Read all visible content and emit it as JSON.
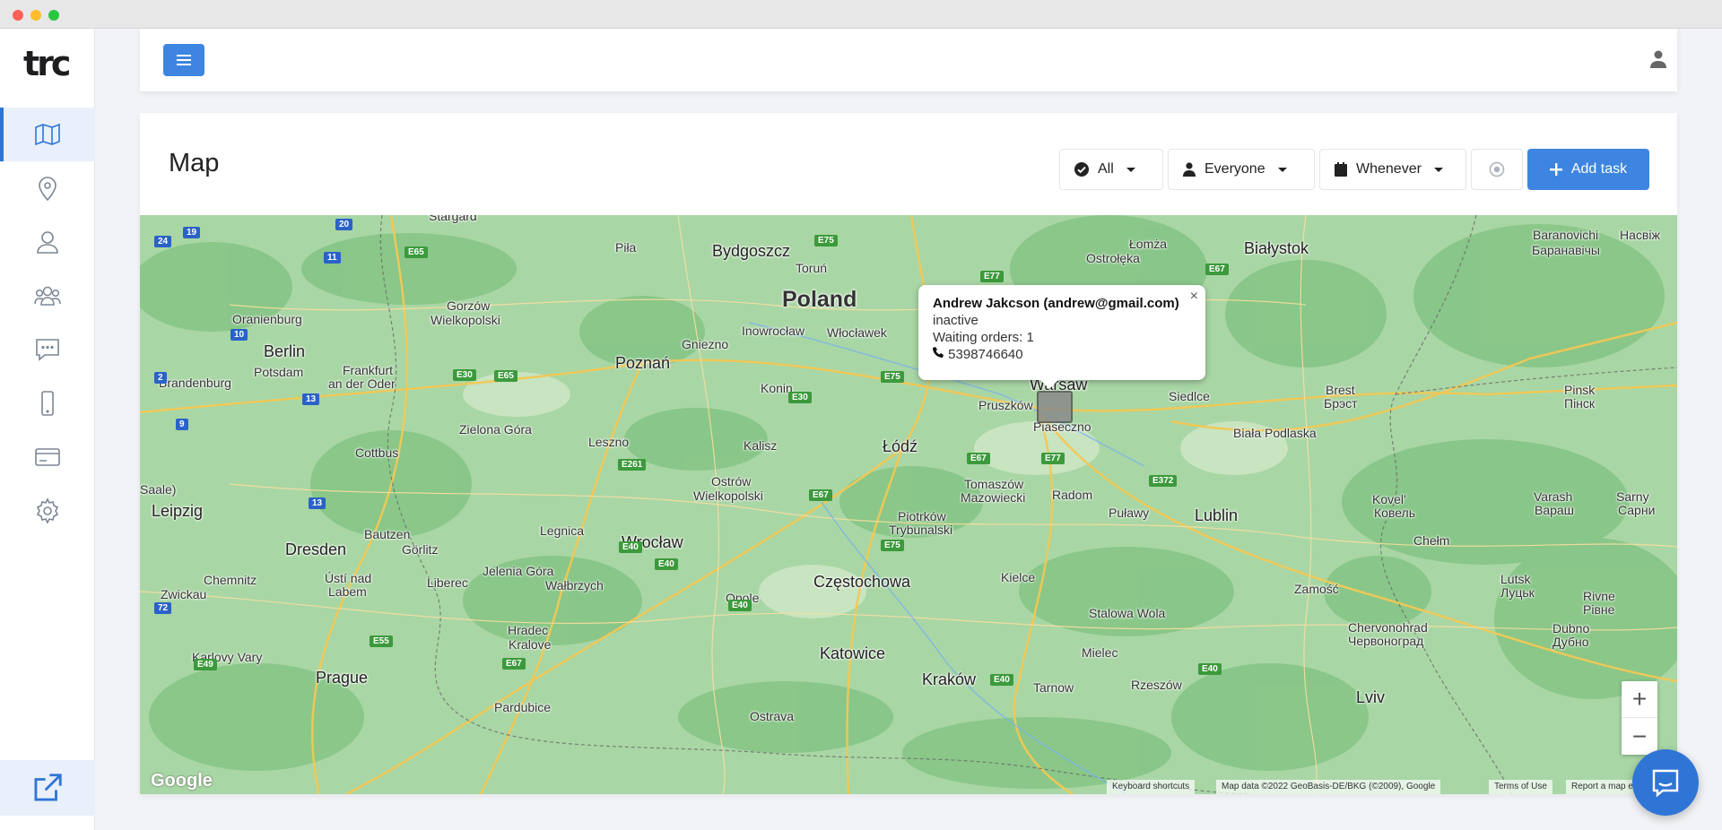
{
  "app": {
    "logo_text": "trc"
  },
  "sidebar": {
    "items": [
      {
        "id": "map",
        "icon": "map-icon",
        "active": true
      },
      {
        "id": "locations",
        "icon": "location-pin-icon"
      },
      {
        "id": "user",
        "icon": "user-icon"
      },
      {
        "id": "team",
        "icon": "users-icon"
      },
      {
        "id": "messages",
        "icon": "chat-icon"
      },
      {
        "id": "devices",
        "icon": "mobile-icon"
      },
      {
        "id": "billing",
        "icon": "credit-card-icon"
      },
      {
        "id": "settings",
        "icon": "gear-icon"
      }
    ],
    "bottom_icon": "external-link-icon"
  },
  "topbar": {
    "menu_icon": "hamburger-icon",
    "user_icon": "user-icon"
  },
  "page": {
    "title": "Map"
  },
  "filters": {
    "status": "All",
    "assignee": "Everyone",
    "date": "Whenever"
  },
  "actions": {
    "add_task": "Add task"
  },
  "popup": {
    "name": "Andrew Jakcson (andrew@gmail.com)",
    "status": "inactive",
    "waiting_orders": "Waiting orders: 1",
    "phone": "5398746640",
    "close": "×"
  },
  "map": {
    "country_label": "Poland",
    "cities": [
      "Bydgoszcz",
      "Białystok",
      "Baranovichi",
      "Насвіж",
      "Баранавічы",
      "Stargard",
      "Piła",
      "Toruń",
      "Łomża",
      "Ostrołęka",
      "Oranienburg",
      "Gorzów",
      "Wielkopolski",
      "Berlin",
      "Inowrocław",
      "Włocławek",
      "Potsdam",
      "Brandenburg",
      "Frankfurt",
      "an der Oder",
      "Poznań",
      "Gniezno",
      "Konin",
      "Warsaw",
      "Pruszków",
      "Piaseczno",
      "Siedlce",
      "Brest",
      "Брэст",
      "Pinsk",
      "Пінск",
      "Zielona Góra",
      "Biała Podlaska",
      "Cottbus",
      "Leszno",
      "Kalisz",
      "Łódź",
      "Saale)",
      "Leipzig",
      "Ostrów",
      "Wielkopolski",
      "Tomaszów",
      "Mazowiecki",
      "Radom",
      "Kovel'",
      "Ковель",
      "Varash",
      "Вараш",
      "Sarny",
      "Сарни",
      "Puławy",
      "Lublin",
      "Piotrków",
      "Trybunalski",
      "Bautzen",
      "Dresden",
      "Görlitz",
      "Legnica",
      "Wrocław",
      "Chełm",
      "Chemnitz",
      "Jelenia Góra",
      "Ústí nad",
      "Labem",
      "Zwickau",
      "Wałbrzych",
      "Liberec",
      "Częstochowa",
      "Kielce",
      "Zamość",
      "Lutsk",
      "Луцьк",
      "Rivne",
      "Рівне",
      "Opole",
      "Stalowa Wola",
      "Chervonohrad",
      "Червоноград",
      "Dubno",
      "Дубно",
      "Karlovy Vary",
      "Hradec",
      "Kralove",
      "Katowice",
      "Mielec",
      "Prague",
      "Kraków",
      "Rzeszów",
      "Tarnow",
      "Pardubice",
      "Lviv",
      "Ostrava"
    ],
    "roads": [
      "E75",
      "E77",
      "E67",
      "E65",
      "E30",
      "E261",
      "E372",
      "E40",
      "E55",
      "E49",
      "20",
      "19",
      "24",
      "11",
      "10",
      "2",
      "13",
      "9",
      "72"
    ],
    "google_logo": "Google",
    "attribution": [
      "Keyboard shortcuts",
      "Map data ©2022 GeoBasis-DE/BKG (©2009), Google",
      "Terms of Use",
      "Report a map error"
    ],
    "zoom_in": "+",
    "zoom_out": "−"
  },
  "chat": {
    "icon": "chat-bubble-icon"
  },
  "colors": {
    "accent": "#3d85e0",
    "map_green": "#9ed19e",
    "map_dark_green": "#86c586"
  }
}
